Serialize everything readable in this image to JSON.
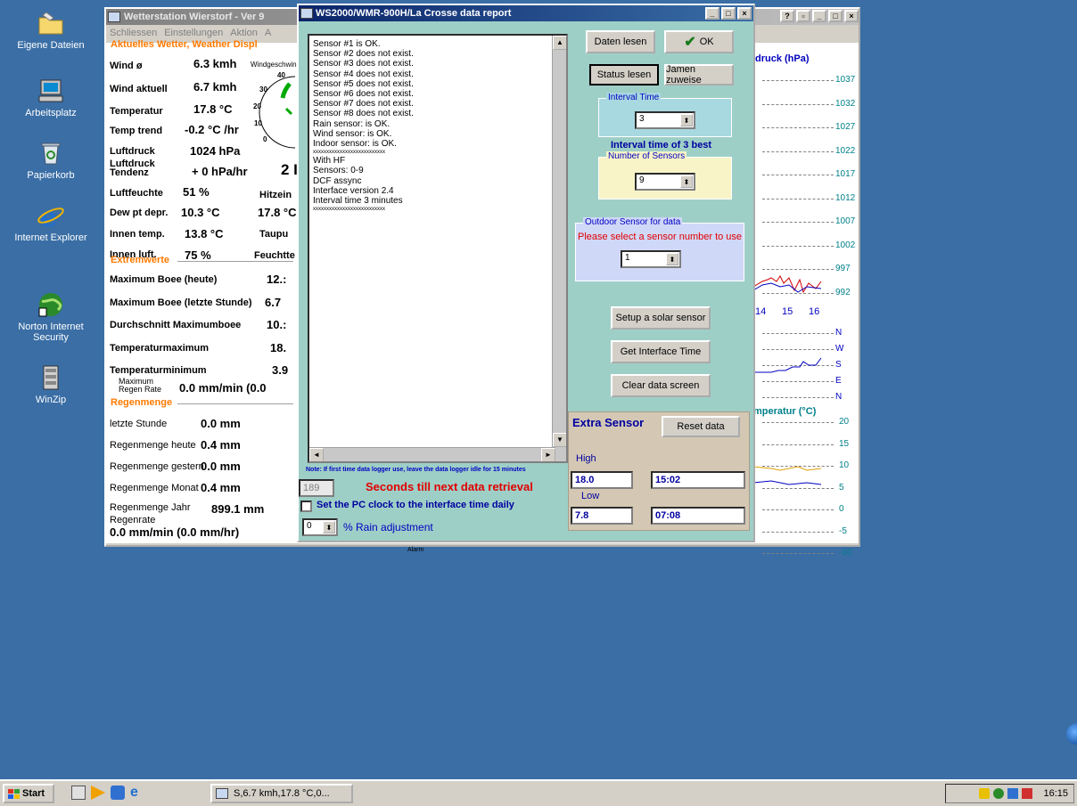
{
  "desktop": {
    "icons": [
      {
        "label": "Eigene Dateien",
        "icon": "folder-icon"
      },
      {
        "label": "Arbeitsplatz",
        "icon": "computer-icon"
      },
      {
        "label": "Papierkorb",
        "icon": "recycle-bin-icon"
      },
      {
        "label": "Internet Explorer",
        "icon": "ie-icon"
      },
      {
        "label": "Norton Internet Security",
        "icon": "globe-icon"
      },
      {
        "label": "WinZip",
        "icon": "winzip-icon"
      }
    ]
  },
  "back_window": {
    "title": "Wetterstation Wierstorf - Ver 9",
    "menu": [
      "Schliessen",
      "Einstellungen",
      "Aktion",
      "A"
    ],
    "current_group": "Aktuelles Wetter, Weather Displ",
    "rows": [
      {
        "label": "Wind ø",
        "value": "6.3 kmh"
      },
      {
        "label": "Wind aktuell",
        "value": "6.7 kmh"
      },
      {
        "label": "Temperatur",
        "value": "17.8 °C"
      },
      {
        "label": "Temp trend",
        "value": "-0.2 °C /hr"
      },
      {
        "label": "Luftdruck",
        "value": "1024 hPa"
      },
      {
        "label": "Luftdruck Tendenz",
        "value": "+ 0 hPa/hr"
      },
      {
        "label": "Luftfeuchte",
        "value": "51 %"
      },
      {
        "label": "Dew pt depr.",
        "value": "10.3 °C"
      },
      {
        "label": "Innen temp.",
        "value": "13.8 °C"
      },
      {
        "label": "Innen luft.",
        "value": "75 %"
      }
    ],
    "gauge_label": "Windgeschwin",
    "gauge_ticks": [
      "40",
      "30",
      "20",
      "10",
      "0"
    ],
    "tendenz_extra": "2 I",
    "side_labels": [
      "Hitzein",
      "17.8 °C",
      "Taupu",
      "Feuchtte"
    ],
    "extreme_group": "Extremwerte",
    "extreme_rows": [
      {
        "label": "Maximum Boee (heute)",
        "value": "12.:"
      },
      {
        "label": "Maximum Boee (letzte Stunde)",
        "value": "6.7"
      },
      {
        "label": "Durchschnitt Maximumboee",
        "value": "10.:"
      },
      {
        "label": "Temperaturmaximum",
        "value": "18."
      },
      {
        "label": "Temperaturminimum",
        "value": "3.9"
      },
      {
        "label": "Maximum Regen Rate",
        "value": "0.0 mm/min (0.0"
      }
    ],
    "rain_group": "Regenmenge",
    "rain_rows": [
      {
        "label": "letzte Stunde",
        "value": "0.0 mm"
      },
      {
        "label": "Regenmenge heute",
        "value": "0.4 mm"
      },
      {
        "label": "Regenmenge gestern",
        "value": "0.0 mm"
      },
      {
        "label": "Regenmenge Monat",
        "value": "0.4 mm"
      },
      {
        "label": "Regenmenge Jahr",
        "value": "899.1 mm"
      }
    ],
    "regenrate_label": "Regenrate",
    "regenrate_value": "0.0 mm/min (0.0 mm/hr)",
    "small_label": "Alarm",
    "chart_pressure_title": "druck (hPa)",
    "pressure_ticks": [
      "1037",
      "1032",
      "1027",
      "1022",
      "1017",
      "1012",
      "1007",
      "1002",
      "997",
      "992"
    ],
    "hour_ticks": [
      "14",
      "15",
      "16"
    ],
    "wind_dir_ticks": [
      "N",
      "W",
      "S",
      "E",
      "N"
    ],
    "chart_temp_title": "mperatur (°C)",
    "temp_ticks": [
      "20",
      "15",
      "10",
      "5",
      "0",
      "-5",
      "-10"
    ]
  },
  "dialog": {
    "title": "WS2000/WMR-900H/La Crosse data report",
    "report_lines": [
      "Sensor #1 is OK.",
      "Sensor #2 does not exist.",
      "Sensor #3 does not exist.",
      "Sensor #4 does not exist.",
      "Sensor #5 does not exist.",
      "Sensor #6 does not exist.",
      "Sensor #7 does not exist.",
      "Sensor #8 does not exist.",
      "Rain sensor: is OK.",
      "Wind sensor: is OK.",
      "Indoor sensor: is OK.",
      "xxxxxxxxxxxxxxxxxxxxxxxxxxx",
      "With HF",
      "Sensors: 0-9",
      "DCF assync",
      "Interface version 2.4",
      "Interval time 3 minutes",
      "xxxxxxxxxxxxxxxxxxxxxxxxxxx"
    ],
    "btn_daten_lesen": "Daten lesen",
    "btn_ok": "OK",
    "btn_status_lesen": "Status lesen",
    "btn_namen": "Jamen zuweise",
    "interval_group": "Interval Time",
    "interval_value": "3",
    "interval_text": "Interval time of 3 best",
    "sensors_group": "Number of Sensors",
    "sensors_value": "9",
    "outdoor_group": "Outdoor Sensor for data",
    "outdoor_prompt": "Please select a sensor number to use",
    "outdoor_value": "1",
    "btn_solar": "Setup a solar sensor",
    "btn_interface_time": "Get Interface Time",
    "btn_clear": "Clear data screen",
    "note": "Note: If first time data logger use, leave the data logger idle for 15 minutes",
    "seconds_value": "189",
    "seconds_text": "Seconds till next data retrieval",
    "clock_checkbox": "Set the PC clock to the interface time daily",
    "rain_adj_value": "0",
    "rain_adj_text": "% Rain adjustment",
    "extra_title": "Extra Sensor",
    "btn_reset": "Reset data",
    "high_label": "High",
    "high_value": "18.0",
    "high_time": "15:02",
    "low_label": "Low",
    "low_value": "7.8",
    "low_time": "07:08"
  },
  "taskbar": {
    "start": "Start",
    "task": "S,6.7 kmh,17.8 °C,0...",
    "clock": "16:15"
  }
}
